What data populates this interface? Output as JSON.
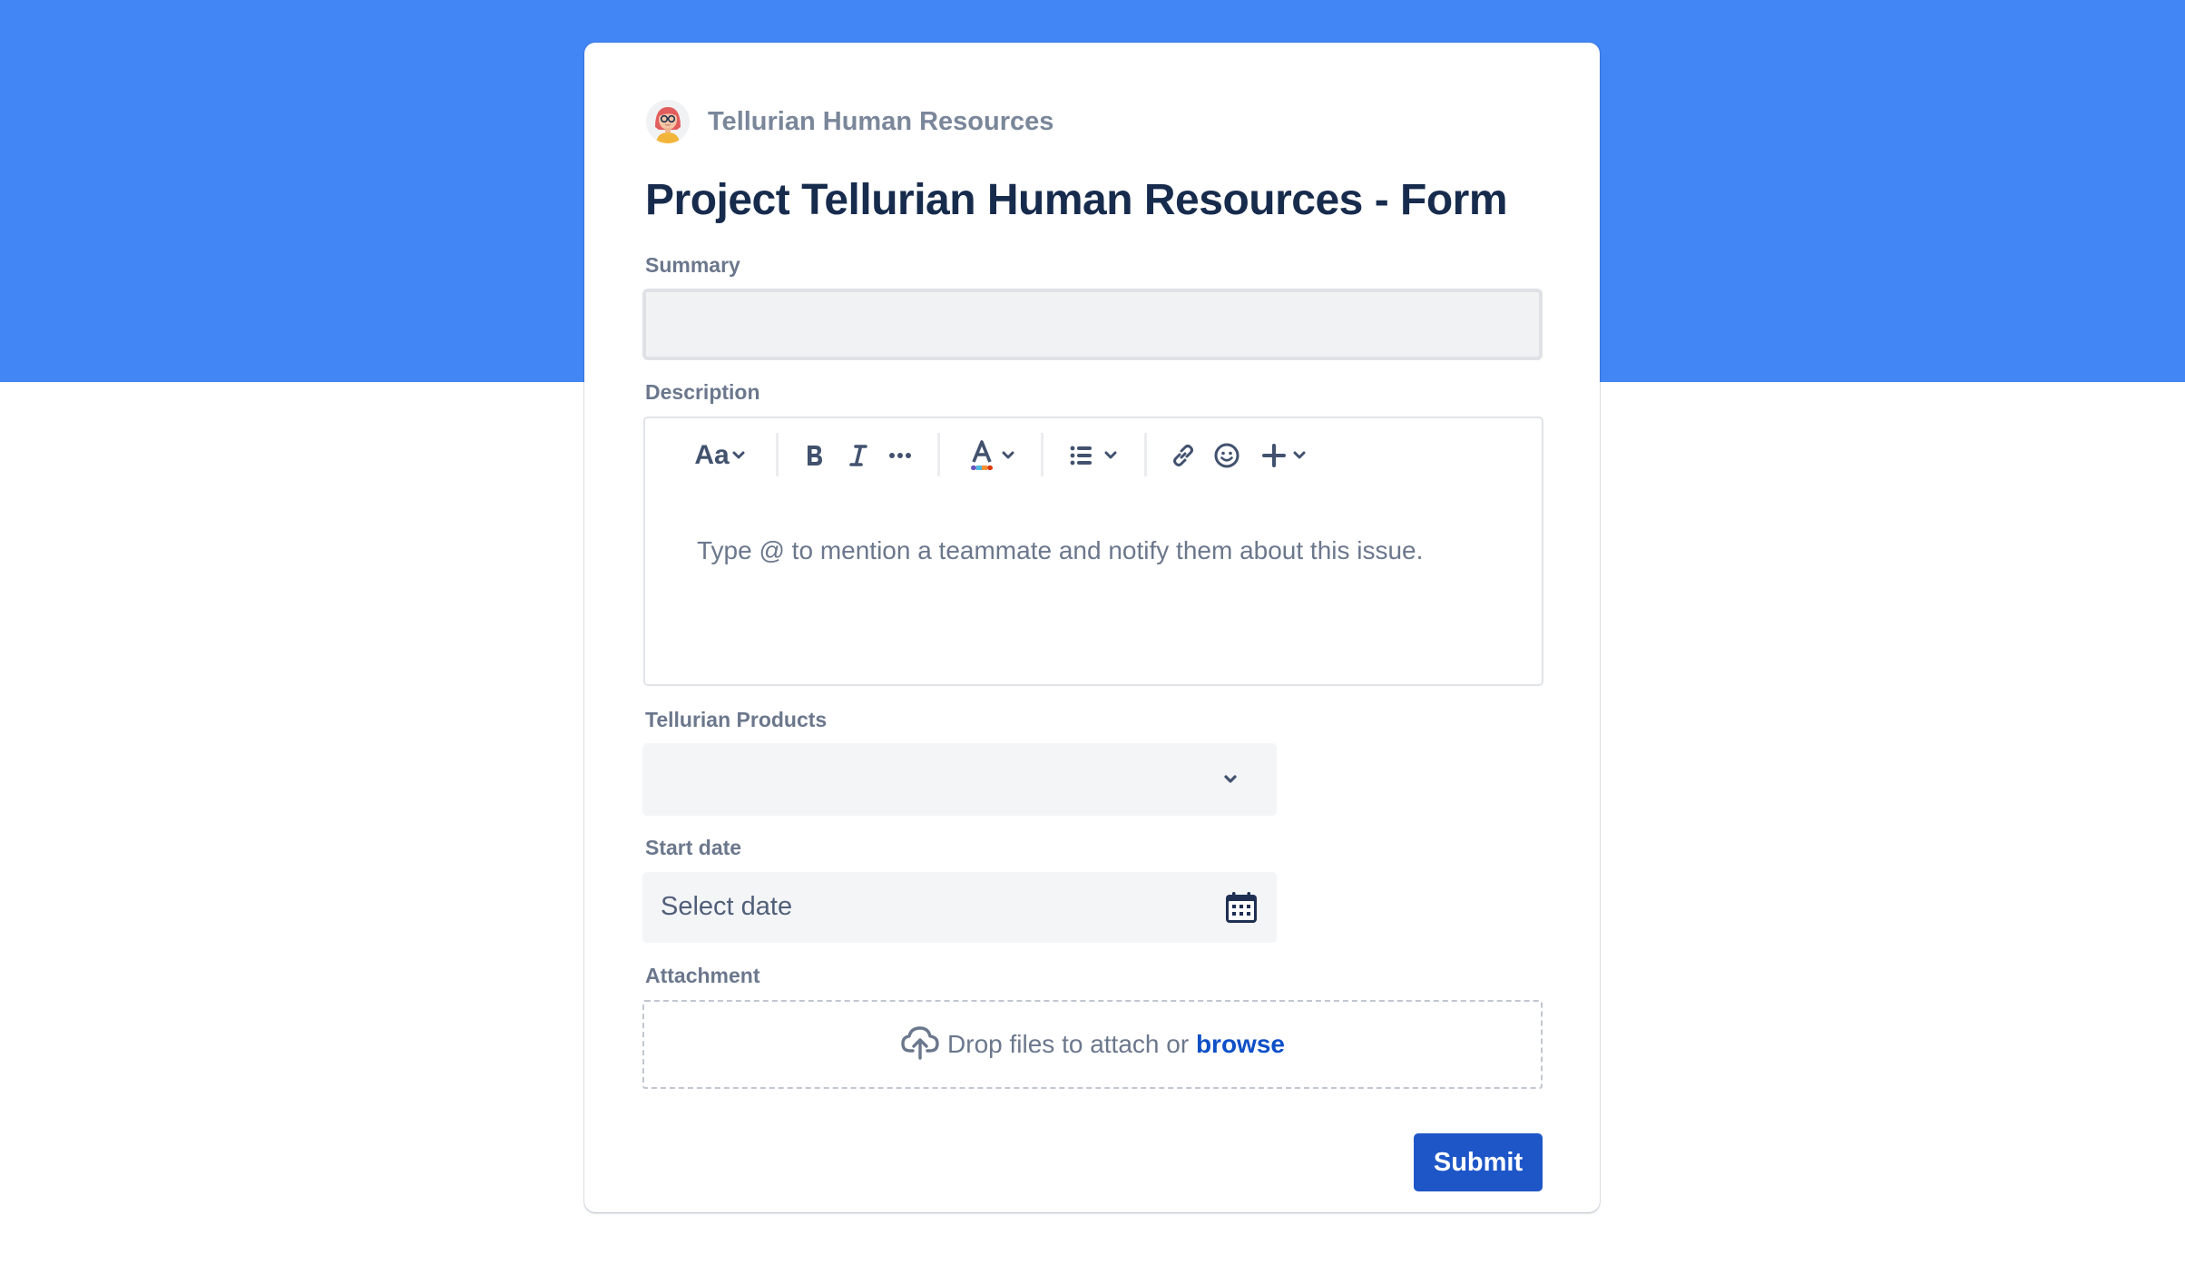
{
  "colors": {
    "header_band": "#4285f4",
    "title": "#172b4d",
    "label": "#6b778c",
    "primary_button": "#1e56c8",
    "link": "#0c4fc7"
  },
  "project": {
    "name": "Tellurian Human Resources",
    "avatar_icon": "woman-with-glasses-avatar-icon"
  },
  "page_title": "Project Tellurian Human Resources - Form",
  "fields": {
    "summary": {
      "label": "Summary",
      "value": ""
    },
    "description": {
      "label": "Description",
      "placeholder": "Type @ to mention a teammate and notify them about this issue.",
      "toolbar": {
        "text_style": "Aa",
        "buttons": [
          "text-style",
          "bold",
          "italic",
          "more-formatting",
          "text-color",
          "list",
          "link",
          "emoji",
          "insert"
        ]
      }
    },
    "products": {
      "label": "Tellurian Products",
      "selected": ""
    },
    "start_date": {
      "label": "Start date",
      "placeholder": "Select date"
    },
    "attachment": {
      "label": "Attachment",
      "drop_text": "Drop files to attach or ",
      "browse_label": "browse"
    }
  },
  "actions": {
    "submit_label": "Submit"
  }
}
